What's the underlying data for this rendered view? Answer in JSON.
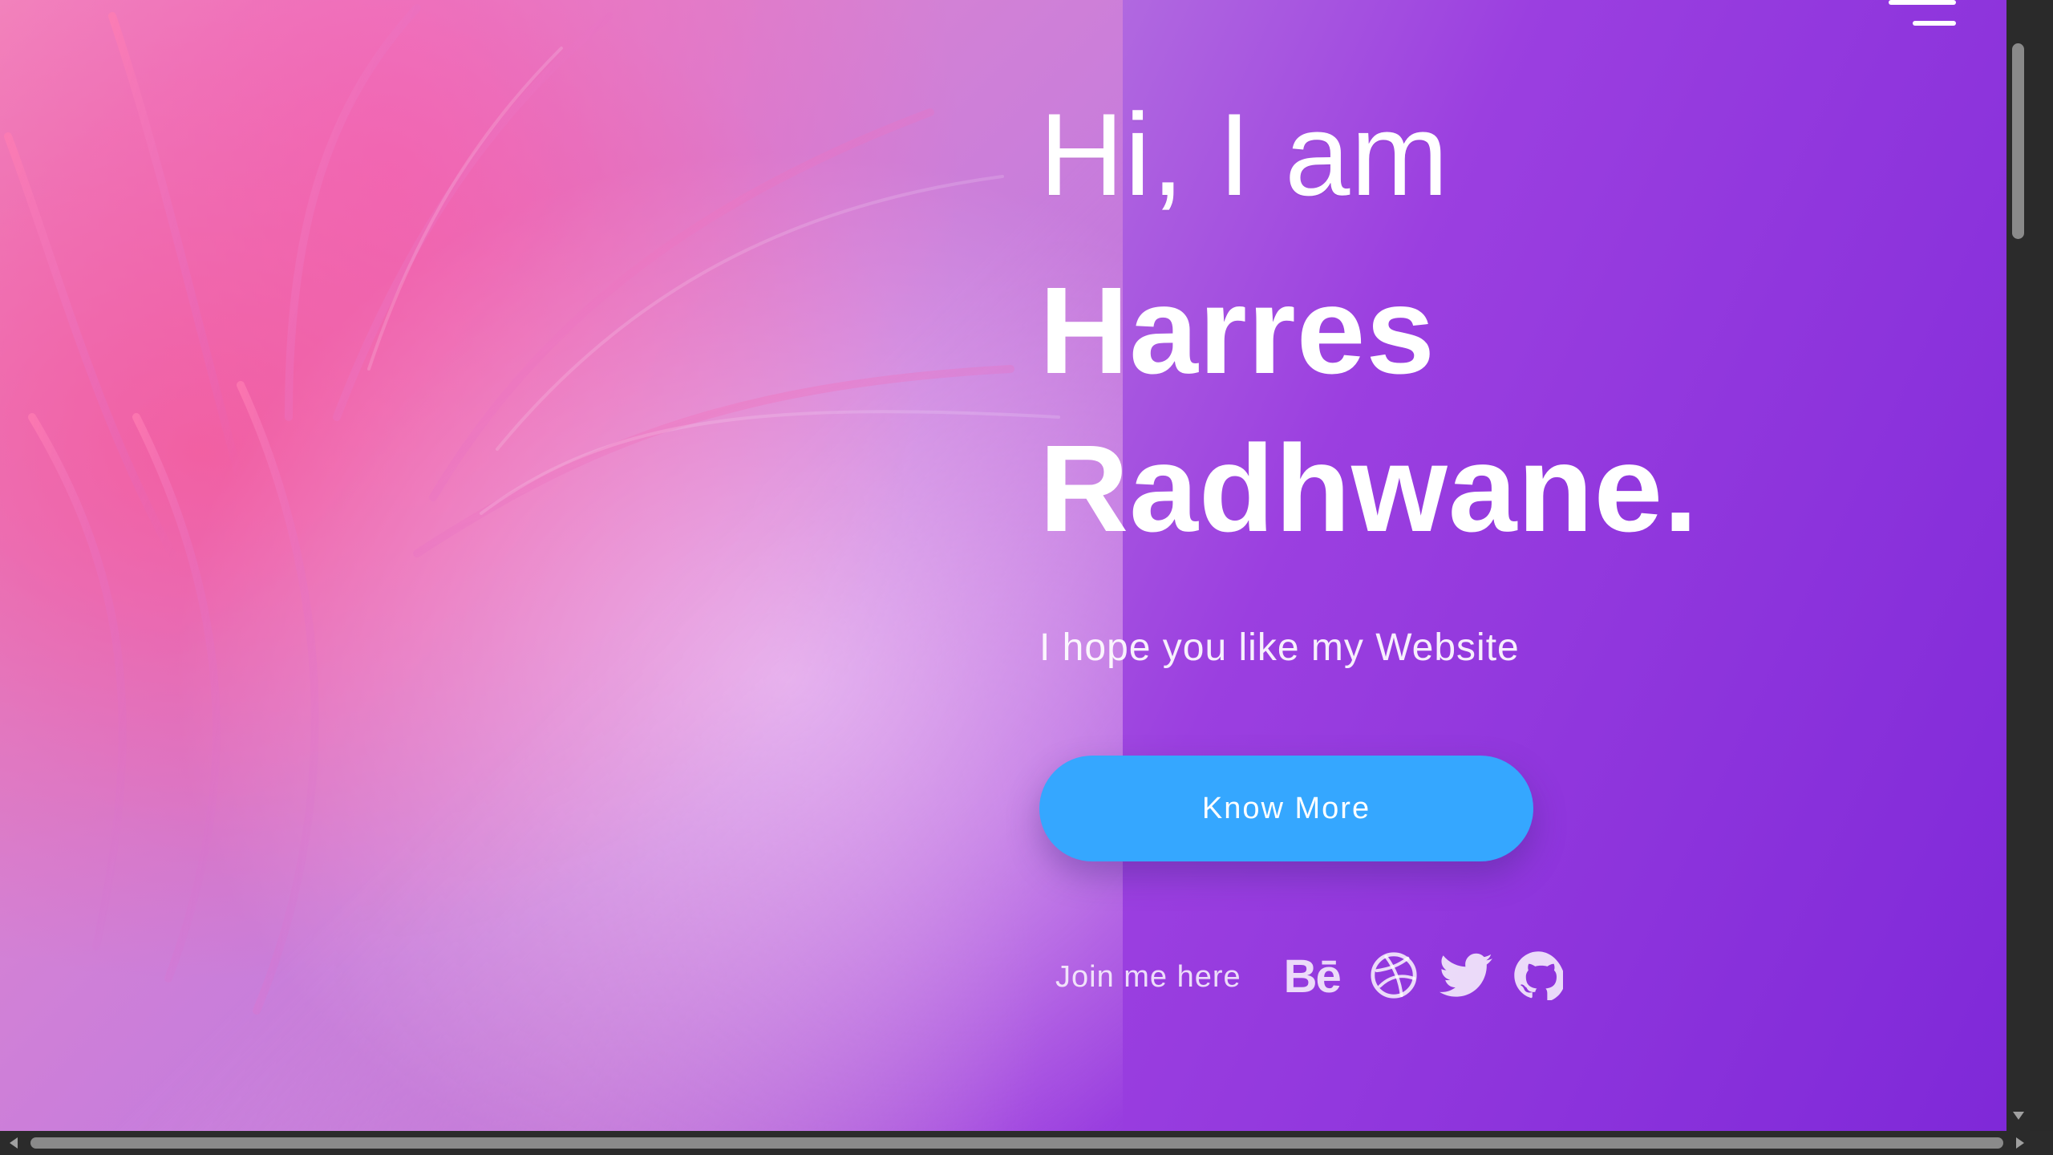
{
  "hero": {
    "greeting": "Hi, I am",
    "name_line1": "Harres",
    "name_line2": "Radhwane.",
    "tagline": "I hope you like my Website",
    "cta_label": "Know More"
  },
  "social": {
    "label": "Join me here",
    "links": [
      {
        "icon": "behance-icon",
        "text": "Bē"
      },
      {
        "icon": "dribbble-icon"
      },
      {
        "icon": "twitter-icon"
      },
      {
        "icon": "github-icon"
      }
    ]
  },
  "colors": {
    "cta_background": "#35a7ff",
    "gradient_start": "#f3a9d2",
    "gradient_end": "#7e28d8",
    "text": "#ffffff"
  },
  "icons": {
    "menu": "hamburger-menu-icon",
    "scroll_down": "scroll-down-arrow-icon",
    "scroll_left": "scroll-left-arrow-icon",
    "scroll_right": "scroll-right-arrow-icon"
  }
}
